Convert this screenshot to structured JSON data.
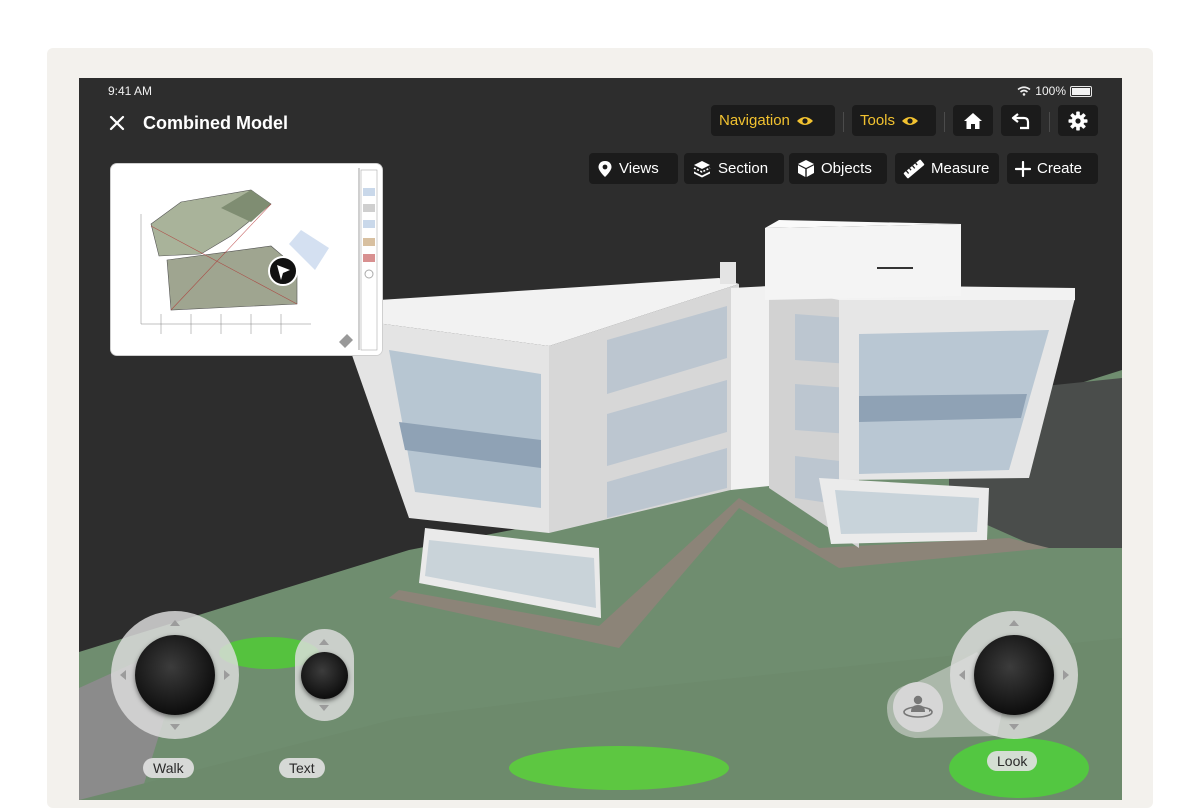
{
  "status_bar": {
    "time": "9:41 AM",
    "battery": "100%"
  },
  "header": {
    "title": "Combined Model"
  },
  "toolbar": {
    "navigation": "Navigation",
    "tools": "Tools"
  },
  "actions": {
    "views": "Views",
    "section": "Section",
    "objects": "Objects",
    "measure": "Measure",
    "create": "Create"
  },
  "controls": {
    "walk": "Walk",
    "text": "Text",
    "look": "Look"
  },
  "colors": {
    "accent": "#f2c230",
    "background": "#2d2d2d",
    "ground": "#6f8d6f",
    "chip": "#1b1b1b"
  },
  "icons": [
    "close-icon",
    "wifi-icon",
    "battery-icon",
    "eye-icon",
    "home-icon",
    "undo-icon",
    "gear-icon",
    "pin-icon",
    "section-box-icon",
    "cube-icon",
    "ruler-icon",
    "plus-icon",
    "person-orbit-icon"
  ]
}
